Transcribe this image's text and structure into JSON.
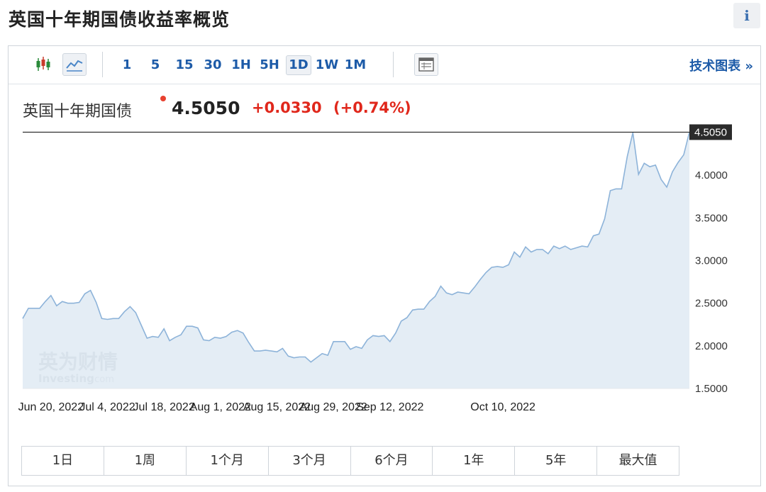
{
  "header": {
    "title": "英国十年期国债收益率概览",
    "info_icon": "i"
  },
  "toolbar": {
    "timeframes": [
      "1",
      "5",
      "15",
      "30",
      "1H",
      "5H",
      "1D",
      "1W",
      "1M"
    ],
    "active_timeframe": "1D",
    "tech_chart_label": "技术图表 »"
  },
  "quote": {
    "name": "英国十年期国债",
    "price": "4.5050",
    "change": "+0.0330",
    "change_pct": "(+0.74%)",
    "change_color": "#e0271b"
  },
  "watermark": {
    "brand_cn": "英为财情",
    "brand_en": "Investing",
    "brand_suffix": ".com"
  },
  "chart_data": {
    "type": "area",
    "y_range": [
      1.5,
      4.6
    ],
    "y_ticks": [
      "4.0000",
      "3.5000",
      "3.0000",
      "2.5000",
      "2.0000",
      "1.5000"
    ],
    "last_price_label": "4.5050",
    "x_ticks": [
      {
        "date": "2022-06-20",
        "label": "Jun 20, 2022"
      },
      {
        "date": "2022-07-04",
        "label": "Jul 4, 2022"
      },
      {
        "date": "2022-07-18",
        "label": "Jul 18, 2022"
      },
      {
        "date": "2022-08-01",
        "label": "Aug 1, 2022"
      },
      {
        "date": "2022-08-15",
        "label": "Aug 15, 2022"
      },
      {
        "date": "2022-08-29",
        "label": "Aug 29, 2022"
      },
      {
        "date": "2022-09-12",
        "label": "Sep 12, 2022"
      },
      {
        "date": "2022-10-10",
        "label": "Oct 10, 2022"
      }
    ],
    "series": [
      {
        "points": [
          [
            "2022-06-13",
            2.32
          ],
          [
            "2022-06-14",
            2.44
          ],
          [
            "2022-06-15",
            2.44
          ],
          [
            "2022-06-16",
            2.44
          ],
          [
            "2022-06-17",
            2.52
          ],
          [
            "2022-06-20",
            2.59
          ],
          [
            "2022-06-21",
            2.47
          ],
          [
            "2022-06-22",
            2.52
          ],
          [
            "2022-06-23",
            2.5
          ],
          [
            "2022-06-24",
            2.5
          ],
          [
            "2022-06-27",
            2.51
          ],
          [
            "2022-06-28",
            2.61
          ],
          [
            "2022-06-29",
            2.65
          ],
          [
            "2022-06-30",
            2.51
          ],
          [
            "2022-07-01",
            2.32
          ],
          [
            "2022-07-04",
            2.31
          ],
          [
            "2022-07-05",
            2.32
          ],
          [
            "2022-07-06",
            2.32
          ],
          [
            "2022-07-07",
            2.4
          ],
          [
            "2022-07-08",
            2.46
          ],
          [
            "2022-07-11",
            2.39
          ],
          [
            "2022-07-12",
            2.24
          ],
          [
            "2022-07-13",
            2.09
          ],
          [
            "2022-07-14",
            2.11
          ],
          [
            "2022-07-15",
            2.1
          ],
          [
            "2022-07-18",
            2.2
          ],
          [
            "2022-07-19",
            2.06
          ],
          [
            "2022-07-20",
            2.1
          ],
          [
            "2022-07-21",
            2.13
          ],
          [
            "2022-07-22",
            2.23
          ],
          [
            "2022-07-25",
            2.23
          ],
          [
            "2022-07-26",
            2.21
          ],
          [
            "2022-07-27",
            2.07
          ],
          [
            "2022-07-28",
            2.06
          ],
          [
            "2022-07-29",
            2.1
          ],
          [
            "2022-08-01",
            2.09
          ],
          [
            "2022-08-02",
            2.11
          ],
          [
            "2022-08-03",
            2.16
          ],
          [
            "2022-08-04",
            2.18
          ],
          [
            "2022-08-05",
            2.15
          ],
          [
            "2022-08-08",
            2.04
          ],
          [
            "2022-08-09",
            1.94
          ],
          [
            "2022-08-10",
            1.94
          ],
          [
            "2022-08-11",
            1.95
          ],
          [
            "2022-08-12",
            1.94
          ],
          [
            "2022-08-15",
            1.93
          ],
          [
            "2022-08-16",
            1.97
          ],
          [
            "2022-08-17",
            1.88
          ],
          [
            "2022-08-18",
            1.86
          ],
          [
            "2022-08-19",
            1.87
          ],
          [
            "2022-08-22",
            1.87
          ],
          [
            "2022-08-23",
            1.81
          ],
          [
            "2022-08-24",
            1.86
          ],
          [
            "2022-08-25",
            1.91
          ],
          [
            "2022-08-26",
            1.89
          ],
          [
            "2022-08-29",
            2.05
          ],
          [
            "2022-08-30",
            2.05
          ],
          [
            "2022-08-31",
            2.05
          ],
          [
            "2022-09-01",
            1.96
          ],
          [
            "2022-09-02",
            1.99
          ],
          [
            "2022-09-05",
            1.97
          ],
          [
            "2022-09-06",
            2.07
          ],
          [
            "2022-09-07",
            2.12
          ],
          [
            "2022-09-08",
            2.11
          ],
          [
            "2022-09-09",
            2.12
          ],
          [
            "2022-09-12",
            2.05
          ],
          [
            "2022-09-13",
            2.15
          ],
          [
            "2022-09-14",
            2.29
          ],
          [
            "2022-09-15",
            2.33
          ],
          [
            "2022-09-16",
            2.42
          ],
          [
            "2022-09-19",
            2.43
          ],
          [
            "2022-09-20",
            2.43
          ],
          [
            "2022-09-21",
            2.52
          ],
          [
            "2022-09-22",
            2.58
          ],
          [
            "2022-09-23",
            2.7
          ],
          [
            "2022-09-26",
            2.62
          ],
          [
            "2022-09-27",
            2.6
          ],
          [
            "2022-09-28",
            2.63
          ],
          [
            "2022-09-29",
            2.62
          ],
          [
            "2022-09-30",
            2.61
          ],
          [
            "2022-10-03",
            2.69
          ],
          [
            "2022-10-04",
            2.78
          ],
          [
            "2022-10-05",
            2.86
          ],
          [
            "2022-10-06",
            2.92
          ],
          [
            "2022-10-07",
            2.93
          ],
          [
            "2022-10-10",
            2.92
          ],
          [
            "2022-10-11",
            2.95
          ],
          [
            "2022-10-12",
            3.1
          ],
          [
            "2022-10-13",
            3.04
          ],
          [
            "2022-10-14",
            3.16
          ],
          [
            "2022-10-17",
            3.1
          ],
          [
            "2022-10-18",
            3.13
          ],
          [
            "2022-10-19",
            3.13
          ],
          [
            "2022-10-20",
            3.08
          ],
          [
            "2022-10-21",
            3.17
          ],
          [
            "2022-10-24",
            3.14
          ],
          [
            "2022-10-25",
            3.17
          ],
          [
            "2022-10-26",
            3.13
          ],
          [
            "2022-10-27",
            3.15
          ],
          [
            "2022-10-28",
            3.17
          ],
          [
            "2022-10-31",
            3.16
          ],
          [
            "2022-11-01",
            3.29
          ],
          [
            "2022-11-02",
            3.31
          ],
          [
            "2022-11-03",
            3.49
          ],
          [
            "2022-11-04",
            3.82
          ],
          [
            "2022-11-07",
            3.84
          ],
          [
            "2022-11-08",
            3.84
          ],
          [
            "2022-11-09",
            4.22
          ],
          [
            "2022-11-10",
            4.5
          ],
          [
            "2022-11-11",
            4.01
          ],
          [
            "2022-11-14",
            4.14
          ],
          [
            "2022-11-15",
            4.1
          ],
          [
            "2022-11-16",
            4.12
          ],
          [
            "2022-11-17",
            3.95
          ],
          [
            "2022-11-18",
            3.86
          ],
          [
            "2022-11-21",
            4.04
          ],
          [
            "2022-11-22",
            4.15
          ],
          [
            "2022-11-23",
            4.24
          ],
          [
            "2022-11-24",
            4.505
          ]
        ]
      }
    ]
  },
  "ranges": [
    "1日",
    "1周",
    "1个月",
    "3个月",
    "6个月",
    "1年",
    "5年",
    "最大值"
  ]
}
